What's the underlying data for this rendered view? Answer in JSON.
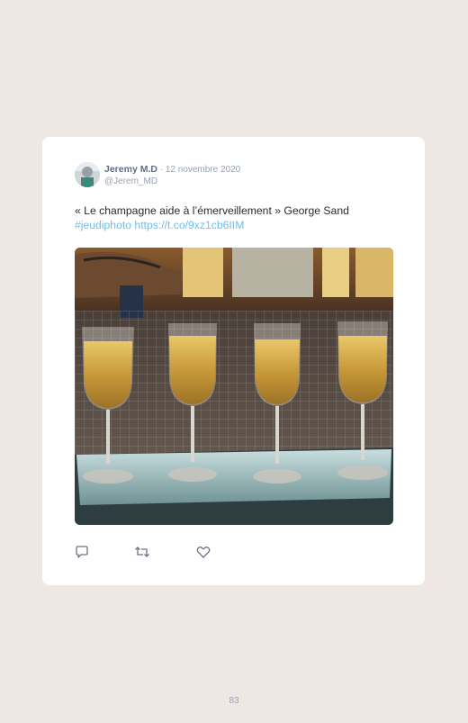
{
  "tweet": {
    "author_name": "Jeremy M.D",
    "separator": " · ",
    "date": "12 novembre 2020",
    "handle": "@Jerem_MD",
    "text": "« Le champagne aide à l’émerveillement » George Sand",
    "hashtag": "#jeudiphoto",
    "link": "https://t.co/9xz1cb6IIM"
  },
  "icons": {
    "reply": "reply-icon",
    "retweet": "retweet-icon",
    "like": "heart-icon"
  },
  "colors": {
    "background": "#eee7e3",
    "card": "#ffffff",
    "link": "#6fbfe6",
    "muted": "#9aa3b1",
    "author": "#5f6b82"
  },
  "page": {
    "number": "83"
  }
}
